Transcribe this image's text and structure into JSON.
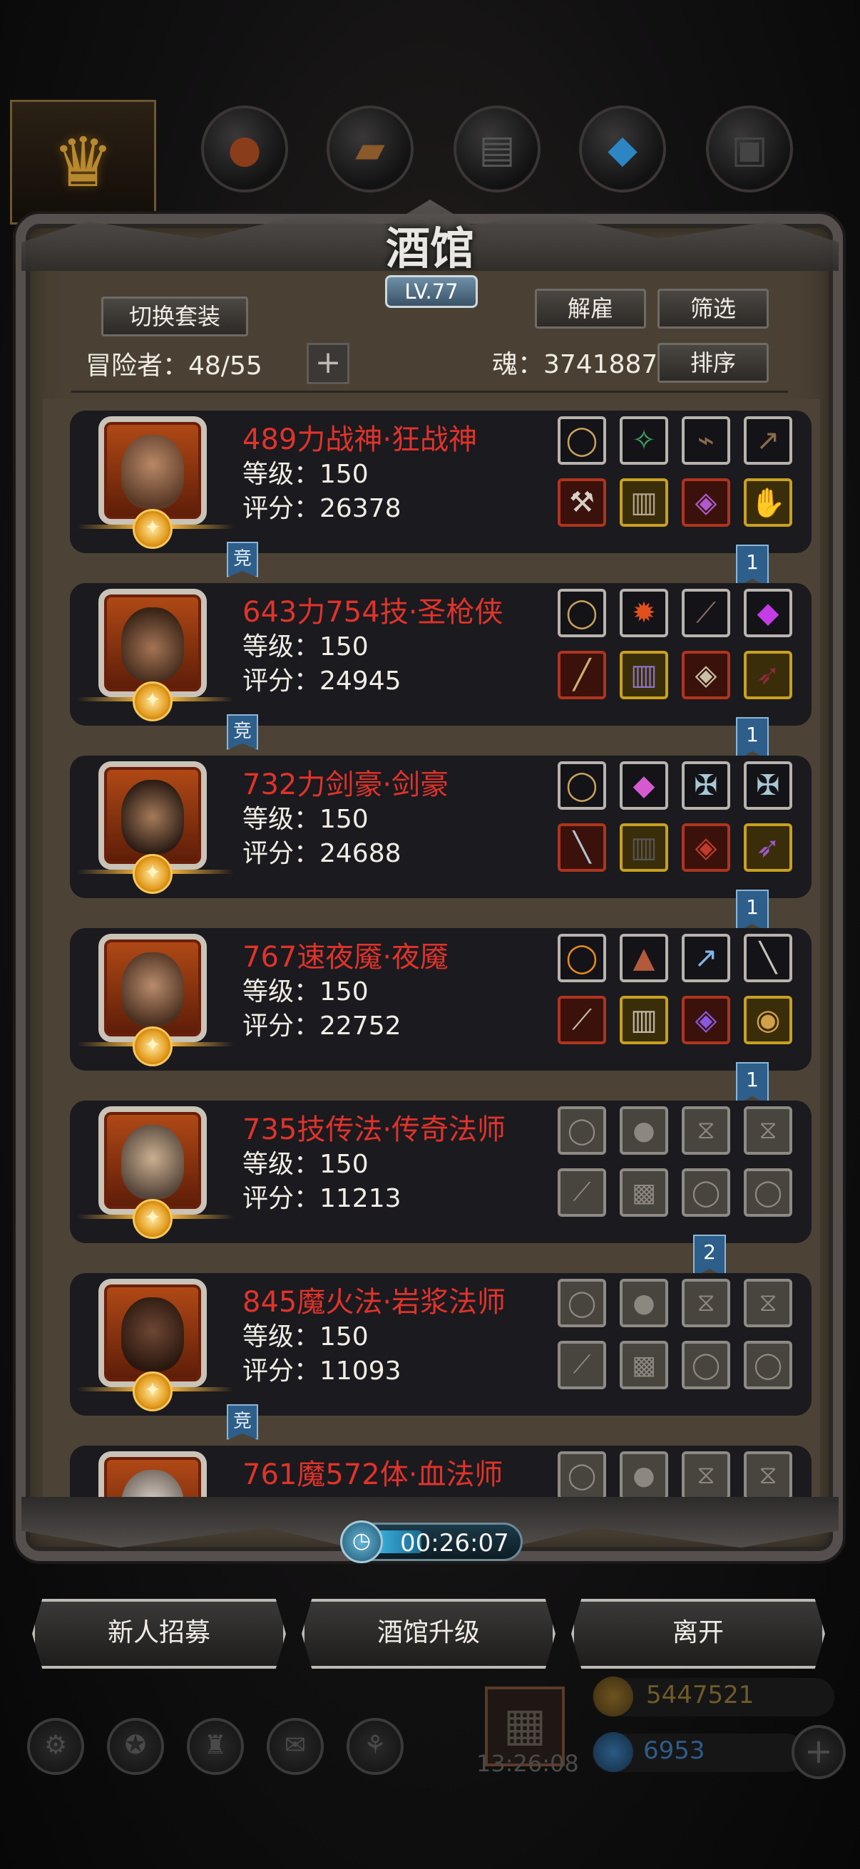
{
  "header": {
    "title": "酒馆",
    "level": "LV.77",
    "switch_set_label": "切换套装",
    "dismiss_label": "解雇",
    "filter_label": "筛选",
    "sort_label": "排序",
    "adventurers_label": "冒险者：48/55",
    "soul_label": "魂：3741887",
    "add_label": "+"
  },
  "heroes": [
    {
      "name": "489力战神·狂战神",
      "level": "等级：150",
      "score": "评分：26378",
      "arena": "竞",
      "rank": "1"
    },
    {
      "name": "643力754技·圣枪侠",
      "level": "等级：150",
      "score": "评分：24945",
      "arena": "竞",
      "rank": "1"
    },
    {
      "name": "732力剑豪·剑豪",
      "level": "等级：150",
      "score": "评分：24688",
      "arena": "",
      "rank": "1"
    },
    {
      "name": "767速夜魇·夜魇",
      "level": "等级：150",
      "score": "评分：22752",
      "arena": "",
      "rank": "1"
    },
    {
      "name": "735技传法·传奇法师",
      "level": "等级：150",
      "score": "评分：11213",
      "arena": "",
      "rank": "2"
    },
    {
      "name": "845魔火法·岩浆法师",
      "level": "等级：150",
      "score": "评分：11093",
      "arena": "竞",
      "rank": ""
    },
    {
      "name": "761魔572体·血法师",
      "level": "",
      "score": "",
      "arena": "",
      "rank": ""
    }
  ],
  "timer": "00:26:07",
  "buttons": {
    "recruit": "新人招募",
    "upgrade": "酒馆升级",
    "leave": "离开"
  },
  "hud": {
    "time": "13:26:08",
    "gold": "5447521",
    "gems": "6953"
  },
  "colors": {
    "hero_name": "#e0332a",
    "accent_blue": "#2e5e8a",
    "panel": "#4a4134"
  }
}
